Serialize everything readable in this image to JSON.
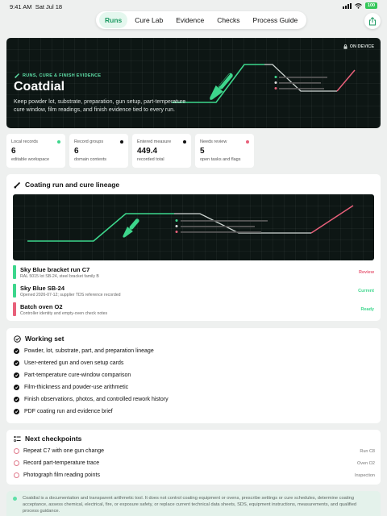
{
  "status": {
    "time": "9:41 AM",
    "date": "Sat Jul 18",
    "battery": "100"
  },
  "nav": {
    "tabs": [
      "Runs",
      "Cure Lab",
      "Evidence",
      "Checks",
      "Process Guide"
    ],
    "active": "Runs"
  },
  "hero": {
    "eyebrow": "RUNS, CURE & FINISH EVIDENCE",
    "title": "Coatdial",
    "description": "Keep powder lot, substrate, preparation, gun setup, part-temperature cure window, film readings, and finish evidence tied to every run.",
    "badge": "ON DEVICE"
  },
  "stats": [
    {
      "label": "Local records",
      "value": "6",
      "sub": "editable workspace",
      "color": "#3dd68c"
    },
    {
      "label": "Record groups",
      "value": "6",
      "sub": "domain contexts",
      "color": "#111111"
    },
    {
      "label": "Entered measure",
      "value": "449.4",
      "sub": "recorded total",
      "color": "#111111"
    },
    {
      "label": "Needs review",
      "value": "5",
      "sub": "open tasks and flags",
      "color": "#e8607a"
    }
  ],
  "lineage": {
    "title": "Coating run and cure lineage",
    "rows": [
      {
        "name": "Sky Blue bracket run C7",
        "meta": "RAL 5015 lot SB-24, steel bracket family B",
        "status": "Review",
        "color": "#3dd68c",
        "status_color": "#e8607a"
      },
      {
        "name": "Sky Blue SB-24",
        "meta": "Opened 2026-07-12; supplier TDS reference recorded",
        "status": "Current",
        "color": "#3dd68c",
        "status_color": "#3dd68c"
      },
      {
        "name": "Batch oven O2",
        "meta": "Controller identity and empty-oven check notes",
        "status": "Ready",
        "color": "#e8607a",
        "status_color": "#3dd68c"
      }
    ]
  },
  "working_set": {
    "title": "Working set",
    "items": [
      "Powder, lot, substrate, part, and preparation lineage",
      "User-entered gun and oven setup cards",
      "Part-temperature cure-window comparison",
      "Film-thickness and powder-use arithmetic",
      "Finish observations, photos, and controlled rework history",
      "PDF coating run and evidence brief"
    ]
  },
  "checkpoints": {
    "title": "Next checkpoints",
    "items": [
      {
        "label": "Repeat C7 with one gun change",
        "tag": "Run C8"
      },
      {
        "label": "Record part-temperature trace",
        "tag": "Oven O2"
      },
      {
        "label": "Photograph film reading points",
        "tag": "Inspection"
      }
    ]
  },
  "disclaimer": "Coatdial is a documentation and transparent arithmetic tool. It does not control coating equipment or ovens, prescribe settings or cure schedules, determine coating acceptance, assess chemical, electrical, fire, or exposure safety, or replace current technical data sheets, SDS, equipment instructions, measurements, and qualified process guidance.",
  "colors": {
    "accent": "#3dd68c",
    "alert": "#e8607a",
    "dark": "#0d1614"
  }
}
